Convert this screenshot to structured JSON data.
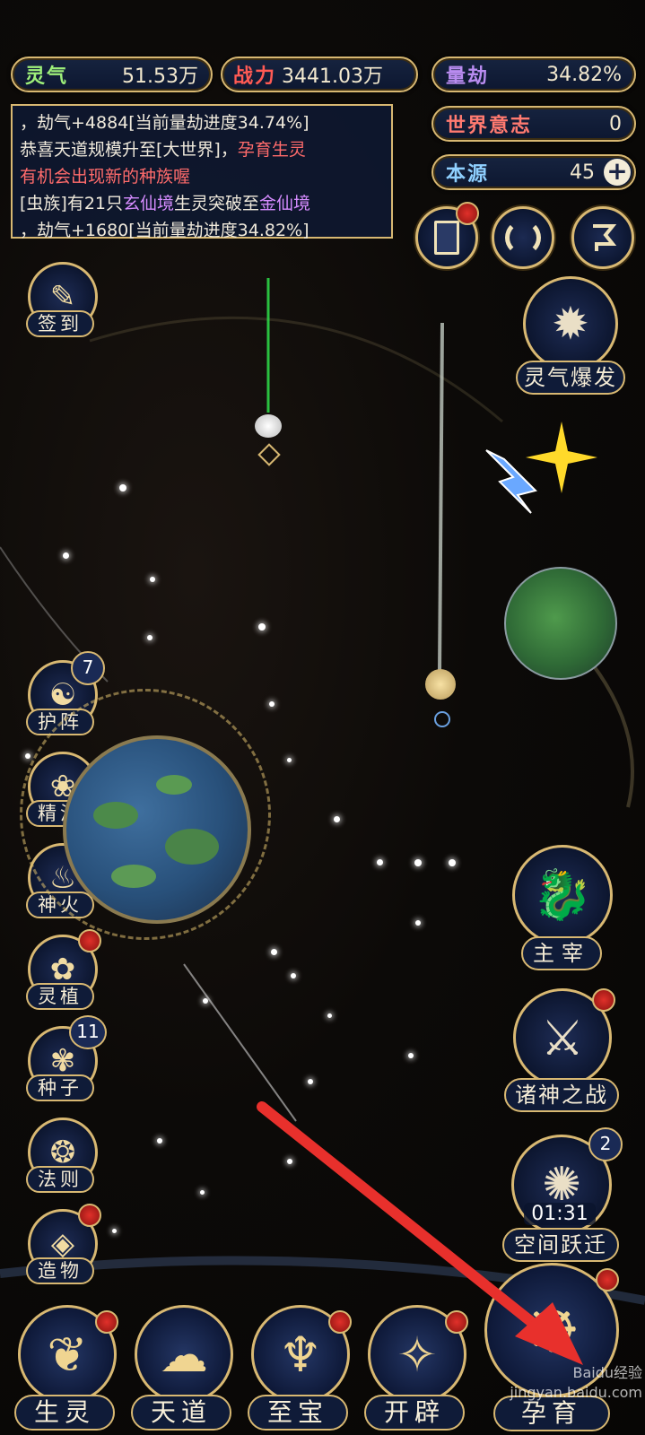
{
  "stats": {
    "lingqi": {
      "label": "灵气",
      "value": "51.53万"
    },
    "zhanli": {
      "label": "战力",
      "value": "3441.03万"
    },
    "liangjie": {
      "label": "量劫",
      "value": "34.82%"
    },
    "shijie": {
      "label": "世界意志",
      "value": "0"
    },
    "benyuan": {
      "label": "本源",
      "value": "45",
      "plus": "+"
    }
  },
  "log": {
    "line1": "，劫气+4884[当前量劫进度34.74%]",
    "line2a": "恭喜天道规模升至[大世界]，",
    "line2b": "孕育生灵",
    "line3": "有机会出现新的种族喔",
    "line4a": "[虫族]有21只",
    "line4b": "玄仙境",
    "line4c": "生灵突破至",
    "line4d": "金仙境",
    "line5": "，劫气+1680[当前量劫进度34.82%]"
  },
  "left_buttons": {
    "qiandao": "签到",
    "huzhen": "护阵",
    "huzhen_badge": "7",
    "jingcui": "精淬",
    "shenhuo": "神火",
    "lingzhi": "灵植",
    "zhongzi": "种子",
    "zhongzi_badge": "11",
    "faze": "法则",
    "zaowu": "造物"
  },
  "right_buttons": {
    "lingqi_baofa": "灵气爆发",
    "zhuzai": "主宰",
    "zhushen": "诸神之战",
    "kongjian": "空间跃迁",
    "kongjian_badge": "2",
    "kongjian_timer": "01:31"
  },
  "bottom_nav": {
    "shengling": "生灵",
    "tiandao": "天道",
    "zhibao": "至宝",
    "kaipi": "开辟",
    "yunyu": "孕育"
  },
  "watermark": "Baidu经验 jingyan.baidu.com",
  "colors": {
    "gold": "#d8b872",
    "panel": "#0f1b38",
    "alert": "#e0302a",
    "arrow": "#e8302c"
  },
  "icons": [
    "pen-scroll-icon",
    "yinyang-icon",
    "lotus-icon",
    "flame-icon",
    "plant-icon",
    "seed-flower-icon",
    "rule-mask-icon",
    "diamond-icon",
    "burst-icon",
    "dragon-icon",
    "sword-icon",
    "portal-icon",
    "card-icon",
    "swirl-icon",
    "flag-icon",
    "plus-icon",
    "lightning-icon",
    "star-icon"
  ]
}
